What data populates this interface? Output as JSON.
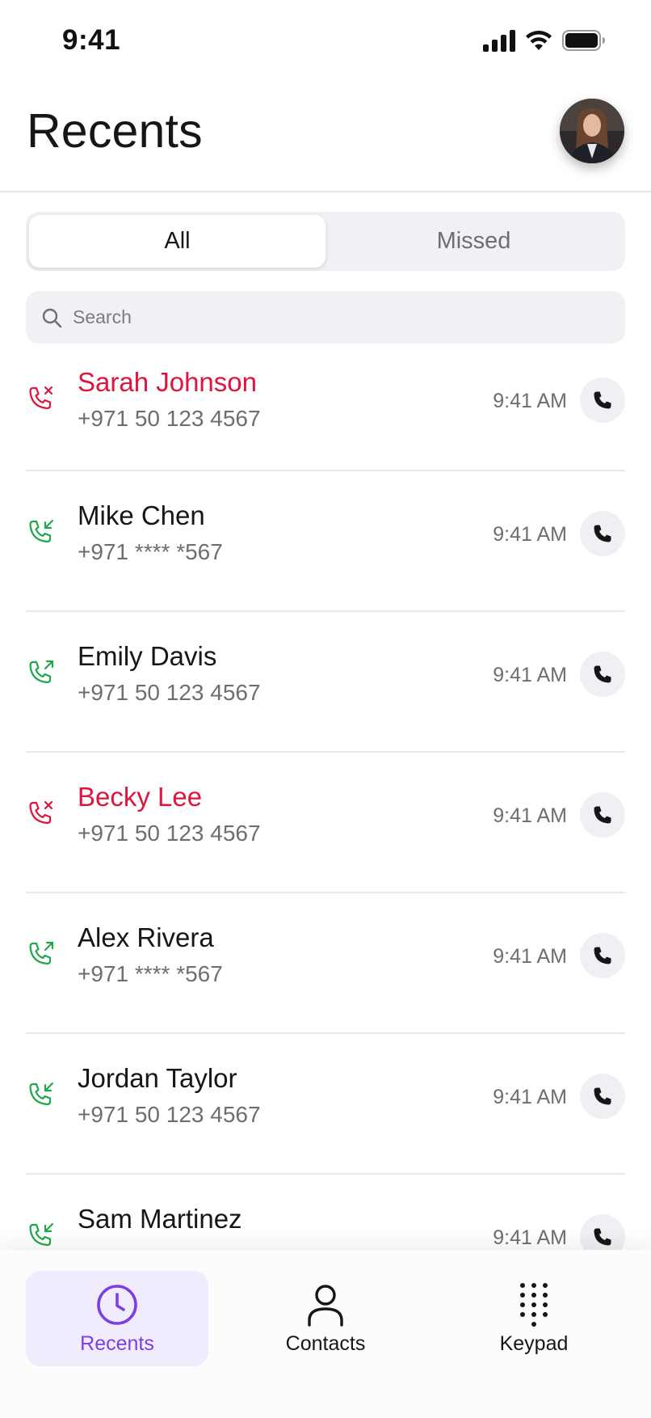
{
  "status_bar": {
    "time": "9:41"
  },
  "header": {
    "title": "Recents"
  },
  "segmented": {
    "all_label": "All",
    "missed_label": "Missed",
    "selected": "All"
  },
  "search": {
    "placeholder": "Search",
    "value": ""
  },
  "calls": [
    {
      "name": "Sarah Johnson",
      "number": "+971 50 123 4567",
      "time": "9:41 AM",
      "type": "missed"
    },
    {
      "name": "Mike Chen",
      "number": "+971 **** *567",
      "time": "9:41 AM",
      "type": "incoming"
    },
    {
      "name": "Emily Davis",
      "number": "+971 50 123 4567",
      "time": "9:41 AM",
      "type": "outgoing"
    },
    {
      "name": "Becky Lee",
      "number": "+971 50 123 4567",
      "time": "9:41 AM",
      "type": "missed"
    },
    {
      "name": "Alex Rivera",
      "number": "+971 **** *567",
      "time": "9:41 AM",
      "type": "outgoing"
    },
    {
      "name": "Jordan Taylor",
      "number": "+971 50 123 4567",
      "time": "9:41 AM",
      "type": "incoming"
    },
    {
      "name": "Sam Martinez",
      "number": "",
      "time": "9:41 AM",
      "type": "incoming"
    }
  ],
  "tab_bar": {
    "recents": {
      "label": "Recents",
      "icon": "clock-icon"
    },
    "contacts": {
      "label": "Contacts",
      "icon": "person-icon"
    },
    "keypad": {
      "label": "Keypad",
      "icon": "keypad-icon"
    },
    "active": "Recents"
  },
  "colors": {
    "accent": "#7b3fe4",
    "accent_bg": "#f1ecfd",
    "missed": "#e0143c",
    "answered": "#1fa84a",
    "text": "#161616",
    "muted": "#6d6d73",
    "surface": "#f1f1f5"
  }
}
